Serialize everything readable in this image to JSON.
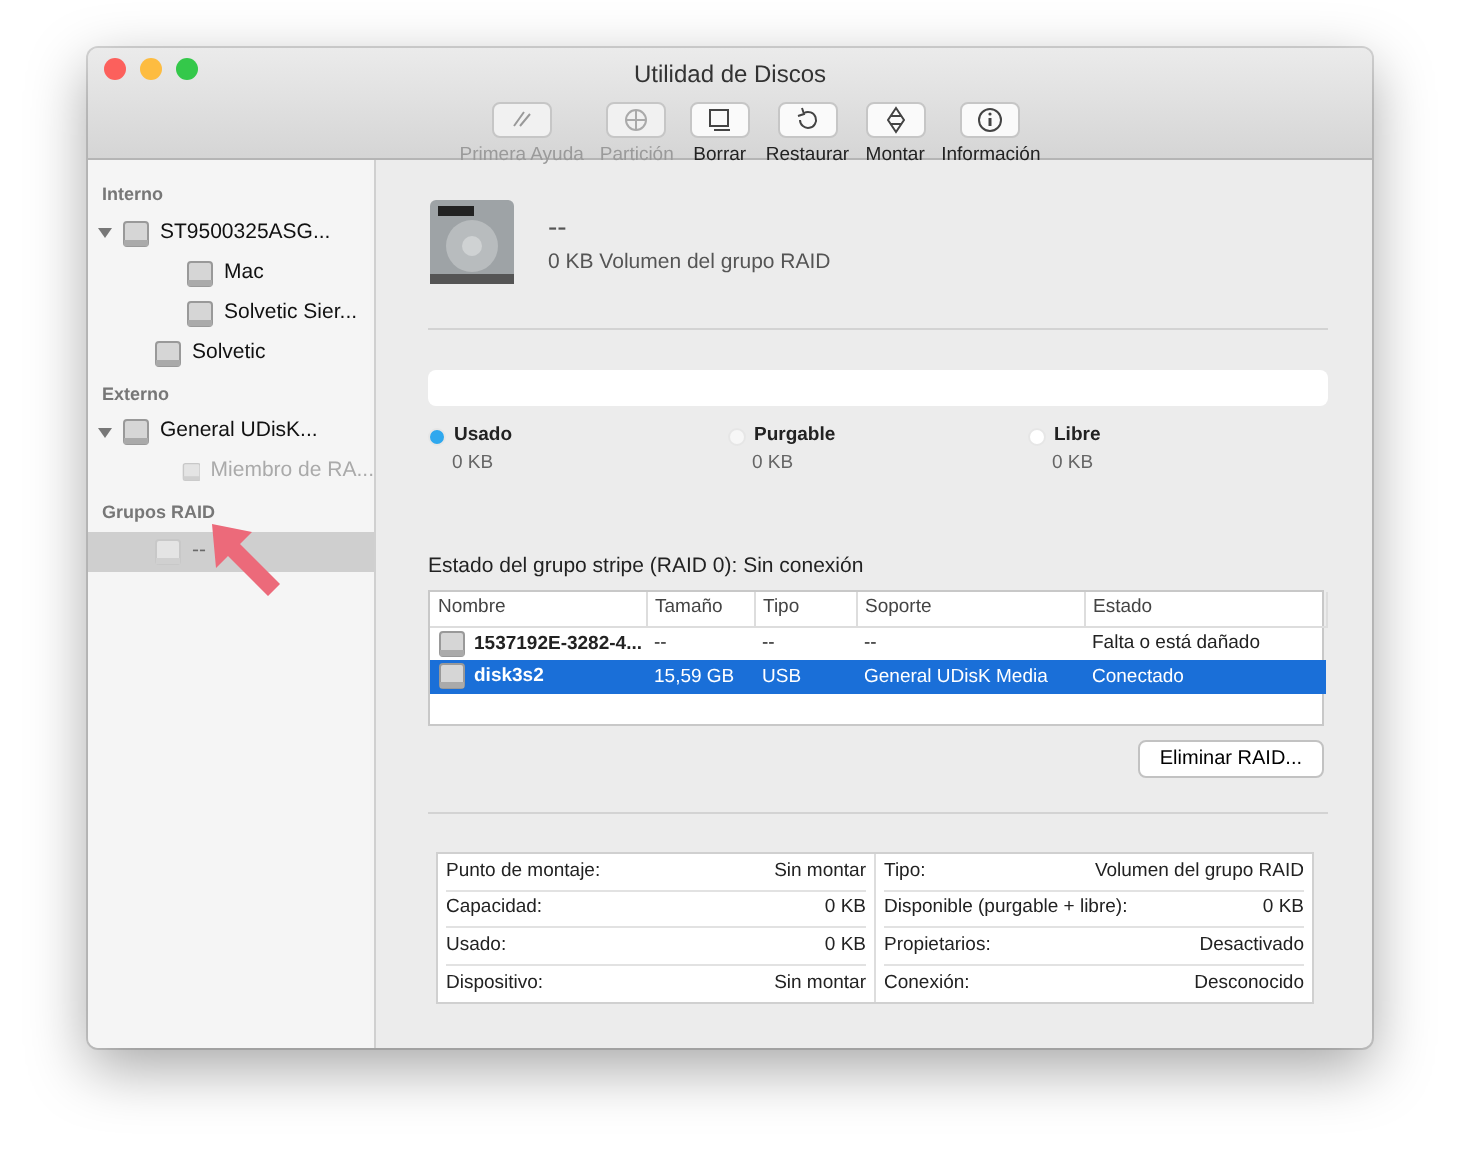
{
  "window": {
    "title": "Utilidad de Discos"
  },
  "toolbar": [
    {
      "label": "Primera Ayuda",
      "disabled": true
    },
    {
      "label": "Partición",
      "disabled": true
    },
    {
      "label": "Borrar",
      "disabled": false
    },
    {
      "label": "Restaurar",
      "disabled": false
    },
    {
      "label": "Montar",
      "disabled": false
    },
    {
      "label": "Información",
      "disabled": false
    }
  ],
  "sidebar": {
    "sections": [
      {
        "heading": "Interno",
        "items": [
          {
            "label": "ST9500325ASG...",
            "expanded": true,
            "selected": false,
            "disabled": false,
            "children": [
              {
                "label": "Mac",
                "selected": false,
                "disabled": false
              },
              {
                "label": "Solvetic Sier...",
                "selected": false,
                "disabled": false
              }
            ]
          },
          {
            "label": "Solvetic",
            "selected": false,
            "disabled": false
          }
        ]
      },
      {
        "heading": "Externo",
        "items": [
          {
            "label": "General UDisK...",
            "expanded": true,
            "selected": false,
            "disabled": false,
            "children": [
              {
                "label": "Miembro de RA...",
                "selected": false,
                "disabled": true
              }
            ]
          }
        ]
      },
      {
        "heading": "Grupos RAID",
        "items": [
          {
            "label": "--",
            "selected": true,
            "disabled": true
          }
        ]
      }
    ]
  },
  "volume": {
    "name": "--",
    "description": "0 KB Volumen del grupo RAID"
  },
  "usage": {
    "legend": [
      {
        "label": "Usado",
        "value": "0 KB",
        "color": "#2fa8ee"
      },
      {
        "label": "Purgable",
        "value": "0 KB",
        "color": "#f7f7f7"
      },
      {
        "label": "Libre",
        "value": "0 KB",
        "color": "#ffffff"
      }
    ]
  },
  "raid": {
    "status": "Estado del grupo stripe (RAID 0): Sin conexión",
    "columns": [
      "Nombre",
      "Tamaño",
      "Tipo",
      "Soporte",
      "Estado"
    ],
    "rows": [
      {
        "selected": false,
        "cells": [
          "1537192E-3282-4...",
          "--",
          "--",
          "--",
          "Falta o está dañado"
        ]
      },
      {
        "selected": true,
        "cells": [
          "disk3s2",
          "15,59 GB",
          "USB",
          "General UDisK Media",
          "Conectado"
        ]
      }
    ],
    "button": "Eliminar RAID..."
  },
  "info": {
    "left": [
      {
        "label": "Punto de montaje:",
        "value": "Sin montar"
      },
      {
        "label": "Capacidad:",
        "value": "0 KB"
      },
      {
        "label": "Usado:",
        "value": "0 KB"
      },
      {
        "label": "Dispositivo:",
        "value": "Sin montar"
      }
    ],
    "right": [
      {
        "label": "Tipo:",
        "value": "Volumen del grupo RAID"
      },
      {
        "label": "Disponible (purgable + libre):",
        "value": "0 KB"
      },
      {
        "label": "Propietarios:",
        "value": "Desactivado"
      },
      {
        "label": "Conexión:",
        "value": "Desconocido"
      }
    ]
  }
}
